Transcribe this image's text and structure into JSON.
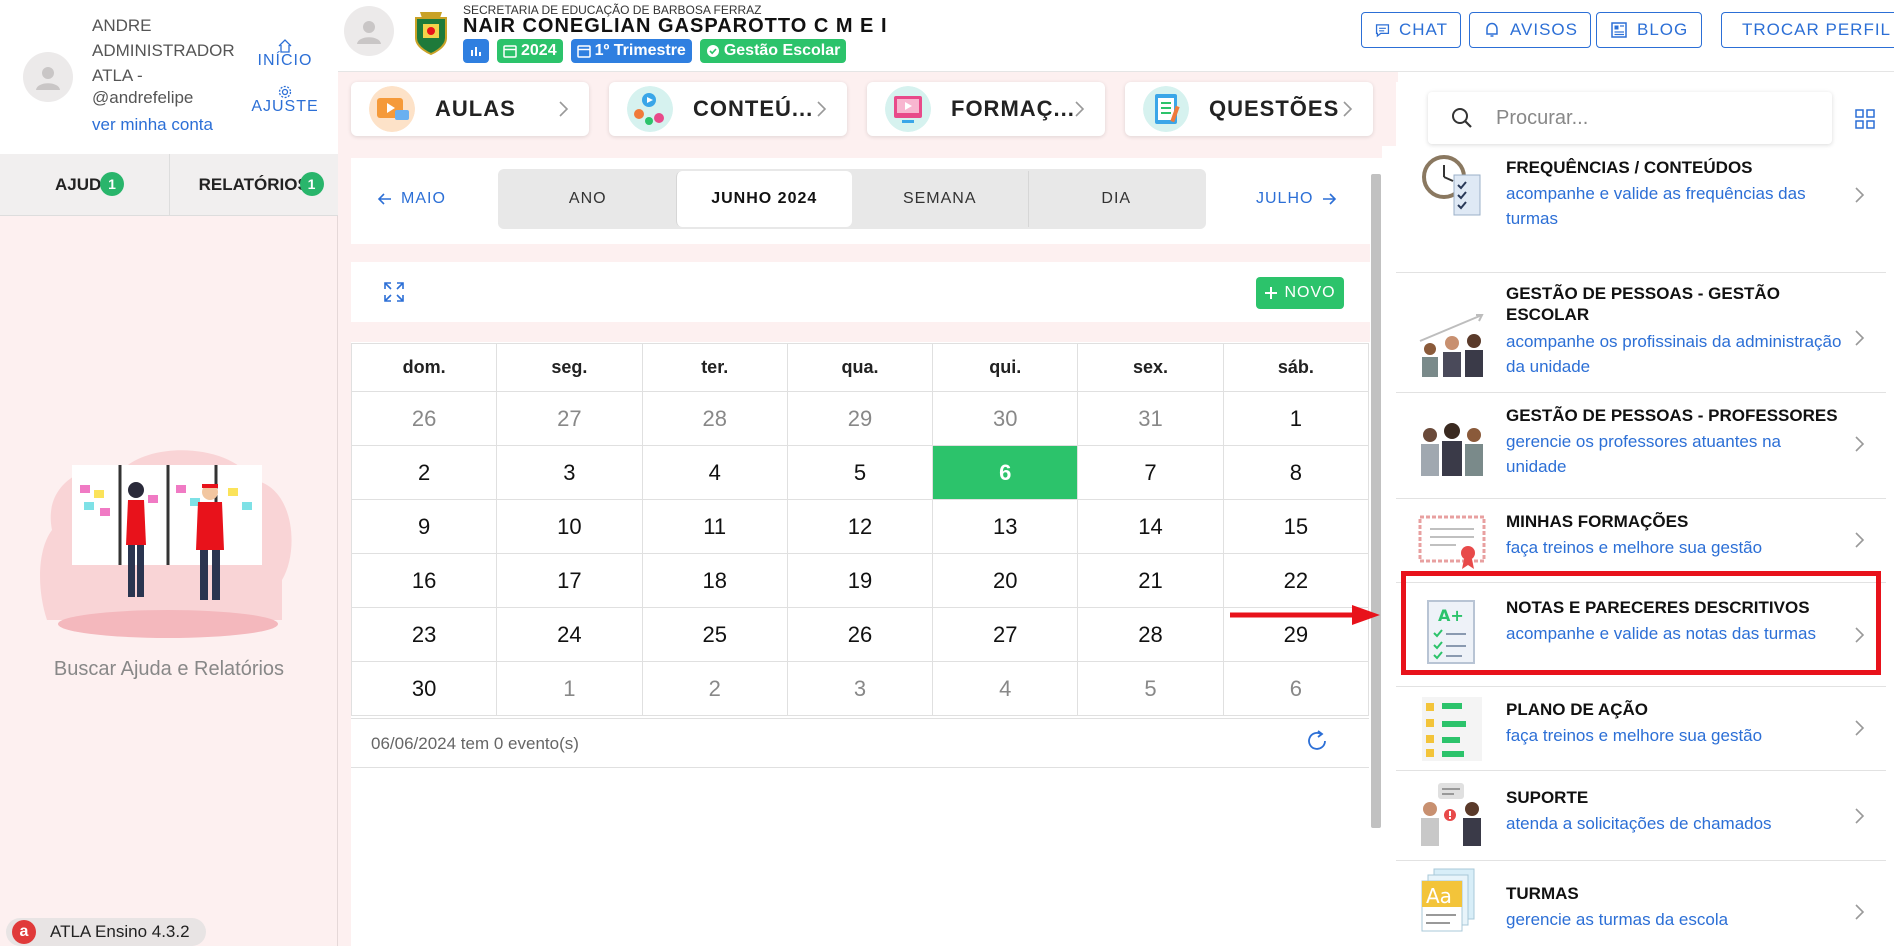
{
  "user": {
    "name": "ANDRE ADMINISTRADOR ATLA -",
    "handle": "@andrefelipe",
    "account_link": "ver minha conta",
    "shortcut_home": "INÍCIO",
    "shortcut_settings": "AJUSTE"
  },
  "left_tabs": [
    {
      "label": "AJUDA",
      "badge": "1"
    },
    {
      "label": "RELATÓRIOS",
      "badge": "1"
    }
  ],
  "help_caption": "Buscar Ajuda e Relatórios",
  "version": "ATLA Ensino 4.3.2",
  "header": {
    "secretaria": "SECRETARIA DE EDUCAÇÃO DE BARBOSA FERRAZ",
    "school": "NAIR CONEGLIAN GASPAROTTO C M E I",
    "chips": [
      "2024",
      "1º Trimestre",
      "Gestão Escolar"
    ],
    "buttons": [
      "CHAT",
      "AVISOS",
      "BLOG",
      "TROCAR PERFIL"
    ]
  },
  "categories": [
    "AULAS",
    "CONTEÚ...",
    "FORMAÇ...",
    "QUESTÕES"
  ],
  "calendar": {
    "prev": "MAIO",
    "next": "JULHO",
    "views": [
      "ANO",
      "JUNHO 2024",
      "SEMANA",
      "DIA"
    ],
    "active_view": "JUNHO 2024",
    "new_button": "NOVO",
    "weekdays": [
      "dom.",
      "seg.",
      "ter.",
      "qua.",
      "qui.",
      "sex.",
      "sáb."
    ],
    "weeks": [
      [
        "26",
        "27",
        "28",
        "29",
        "30",
        "31",
        "1"
      ],
      [
        "2",
        "3",
        "4",
        "5",
        "6",
        "7",
        "8"
      ],
      [
        "9",
        "10",
        "11",
        "12",
        "13",
        "14",
        "15"
      ],
      [
        "16",
        "17",
        "18",
        "19",
        "20",
        "21",
        "22"
      ],
      [
        "23",
        "24",
        "25",
        "26",
        "27",
        "28",
        "29"
      ],
      [
        "30",
        "1",
        "2",
        "3",
        "4",
        "5",
        "6"
      ]
    ],
    "today": "6",
    "footer": "06/06/2024 tem 0 evento(s)"
  },
  "search": {
    "placeholder": "Procurar..."
  },
  "menu": [
    {
      "title": "FREQUÊNCIAS / CONTEÚDOS",
      "desc": "acompanhe e valide as frequências das turmas",
      "icon": "clock-checklist-icon"
    },
    {
      "title": "GESTÃO DE PESSOAS - GESTÃO ESCOLAR",
      "desc": "acompanhe os profissinais da administração da unidade",
      "icon": "people-growth-icon"
    },
    {
      "title": "GESTÃO DE PESSOAS - PROFESSORES",
      "desc": "gerencie os professores atuantes na unidade",
      "icon": "teachers-icon"
    },
    {
      "title": "MINHAS FORMAÇÕES",
      "desc": "faça treinos e melhore sua gestão",
      "icon": "certificate-icon"
    },
    {
      "title": "NOTAS E PARECERES DESCRITIVOS",
      "desc": "acompanhe e valide as notas das turmas",
      "icon": "grade-document-icon"
    },
    {
      "title": "PLANO DE AÇÃO",
      "desc": "faça treinos e melhore sua gestão",
      "icon": "action-plan-icon"
    },
    {
      "title": "SUPORTE",
      "desc": "atenda a solicitações de chamados",
      "icon": "support-icon"
    },
    {
      "title": "TURMAS",
      "desc": "gerencie as turmas da escola",
      "icon": "classes-icon"
    }
  ],
  "colors": {
    "accent": "#2c6fd6",
    "success": "#2cc36b",
    "highlight": "#e8121b",
    "sidebar_bg": "#fdf0f0"
  }
}
